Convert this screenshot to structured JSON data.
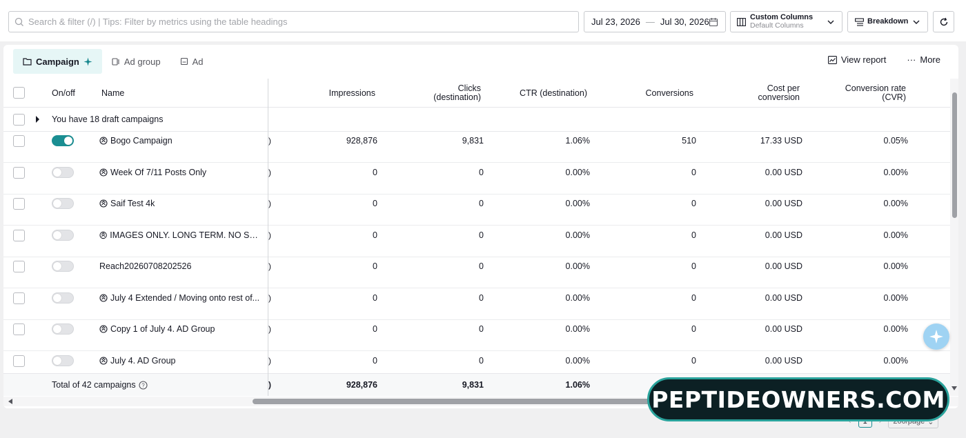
{
  "search": {
    "placeholder": "Search & filter (/) | Tips: Filter by metrics using the table headings"
  },
  "date_range": {
    "start": "Jul 23, 2026",
    "separator": "—",
    "end": "Jul 30, 2026"
  },
  "custom_columns": {
    "label": "Custom Columns",
    "value": "Default Columns"
  },
  "breakdown": {
    "label": "Breakdown"
  },
  "tabs": [
    {
      "label": "Campaign",
      "active": true
    },
    {
      "label": "Ad group",
      "active": false
    },
    {
      "label": "Ad",
      "active": false
    }
  ],
  "actions": {
    "view_report": "View report",
    "more": "More"
  },
  "headers": {
    "onoff": "On/off",
    "name": "Name",
    "impressions": "Impressions",
    "clicks_1": "Clicks",
    "clicks_2": "(destination)",
    "ctr": "CTR (destination)",
    "conversions": "Conversions",
    "cpc_1": "Cost per",
    "cpc_2": "conversion",
    "cvr_1": "Conversion rate",
    "cvr_2": "(CVR)"
  },
  "draft_banner": "You have 18 draft campaigns",
  "rows": [
    {
      "name": "Bogo Campaign",
      "on": true,
      "clip": ")",
      "impressions": "928,876",
      "clicks": "9,831",
      "ctr": "1.06%",
      "conversions": "510",
      "cost": "17.33 USD",
      "cvr": "0.05%"
    },
    {
      "name": "Week Of 7/11 Posts Only",
      "on": false,
      "clip": ")",
      "impressions": "0",
      "clicks": "0",
      "ctr": "0.00%",
      "conversions": "0",
      "cost": "0.00 USD",
      "cvr": "0.00%"
    },
    {
      "name": "Saif Test 4k",
      "on": false,
      "clip": ")",
      "impressions": "0",
      "clicks": "0",
      "ctr": "0.00%",
      "conversions": "0",
      "cost": "0.00 USD",
      "cvr": "0.00%"
    },
    {
      "name": "IMAGES ONLY. LONG TERM. NO SALE...",
      "on": false,
      "clip": ")",
      "impressions": "0",
      "clicks": "0",
      "ctr": "0.00%",
      "conversions": "0",
      "cost": "0.00 USD",
      "cvr": "0.00%"
    },
    {
      "name": "Reach20260708202526",
      "on": false,
      "clip": ")",
      "impressions": "0",
      "clicks": "0",
      "ctr": "0.00%",
      "conversions": "0",
      "cost": "0.00 USD",
      "cvr": "0.00%"
    },
    {
      "name": "July 4 Extended / Moving onto rest of...",
      "on": false,
      "clip": ")",
      "impressions": "0",
      "clicks": "0",
      "ctr": "0.00%",
      "conversions": "0",
      "cost": "0.00 USD",
      "cvr": "0.00%"
    },
    {
      "name": "Copy 1 of July 4. AD Group",
      "on": false,
      "clip": ")",
      "impressions": "0",
      "clicks": "0",
      "ctr": "0.00%",
      "conversions": "0",
      "cost": "0.00 USD",
      "cvr": "0.00%"
    },
    {
      "name": "July 4. AD Group",
      "on": false,
      "clip": ")",
      "impressions": "0",
      "clicks": "0",
      "ctr": "0.00%",
      "conversions": "0",
      "cost": "0.00 USD",
      "cvr": "0.00%"
    }
  ],
  "totals": {
    "label": "Total of 42 campaigns",
    "clip": ")",
    "impressions": "928,876",
    "clicks": "9,831",
    "ctr": "1.06%"
  },
  "pagination": {
    "page": "1",
    "per_page": "200/page"
  },
  "watermark": "PEPTIDEOWNERS.COM",
  "colors": {
    "accent": "#1a8e92",
    "tab_active_bg": "#e6f6f6",
    "badge_bg": "#0c2024",
    "badge_border": "#2aa39c"
  }
}
